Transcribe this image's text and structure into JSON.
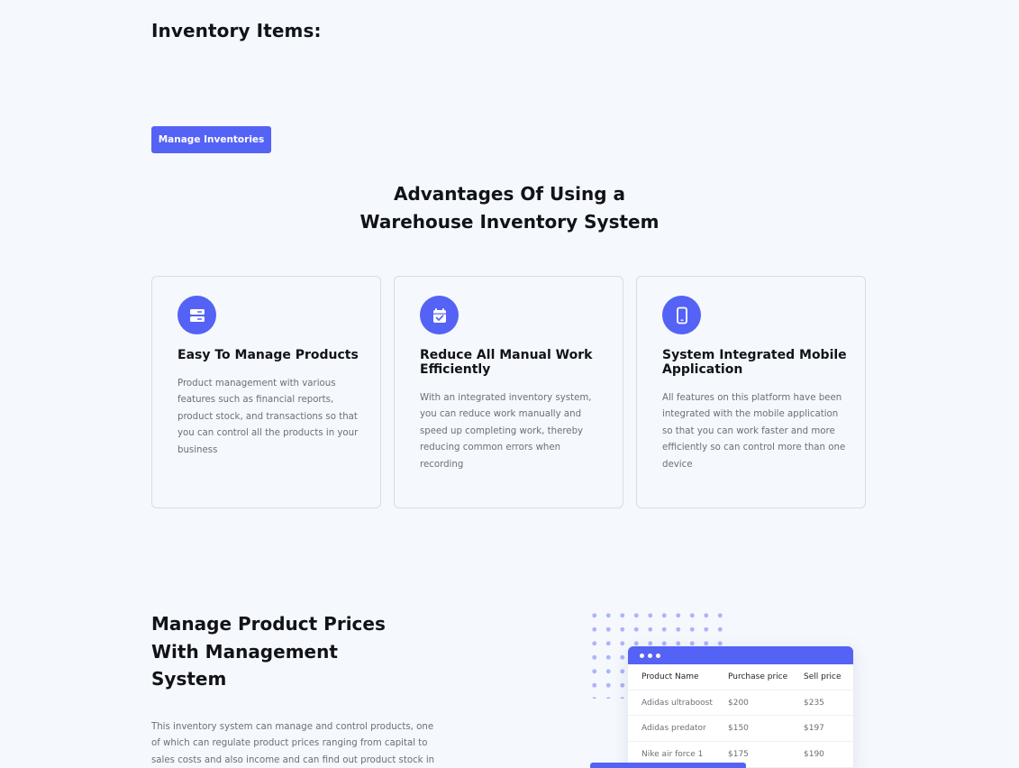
{
  "inventory": {
    "title": "Inventory Items:"
  },
  "manage_button": {
    "label": "Manage Inventories"
  },
  "advantages": {
    "heading_line1": "Advantages Of Using a",
    "heading_line2": "Warehouse Inventory System",
    "cards": [
      {
        "icon": "server-icon",
        "title": "Easy To Manage Products",
        "description": "Product management with various features such as financial reports, product stock, and transactions so that you can control all the products in your business"
      },
      {
        "icon": "calendar-check-icon",
        "title": "Reduce All Manual Work Efficiently",
        "description": "With an integrated inventory system, you can reduce work manually and speed up completing work, thereby reducing common errors when recording"
      },
      {
        "icon": "mobile-phone-icon",
        "title": "System Integrated Mobile Application",
        "description": "All features on this platform have been integrated with the mobile application so that you can work faster and more efficiently so can control more than one device"
      }
    ]
  },
  "manage_prices": {
    "heading": "Manage Product Prices With Management System",
    "description": "This inventory system can manage and control products, one of which can regulate product prices ranging from capital to sales costs and also income and can find out product stock in the"
  },
  "price_table": {
    "headers": [
      "Product Name",
      "Purchase price",
      "Sell price"
    ],
    "rows": [
      [
        "Adidas ultraboost",
        "$200",
        "$235"
      ],
      [
        "Adidas predator",
        "$150",
        "$197"
      ],
      [
        "Nike air force 1",
        "$175",
        "$190"
      ]
    ]
  },
  "colors": {
    "accent": "#5462f5",
    "background": "#f5f9fd",
    "text": "#111318",
    "muted_text": "#6b6f77",
    "dot_pattern": "#aeb4fb"
  }
}
